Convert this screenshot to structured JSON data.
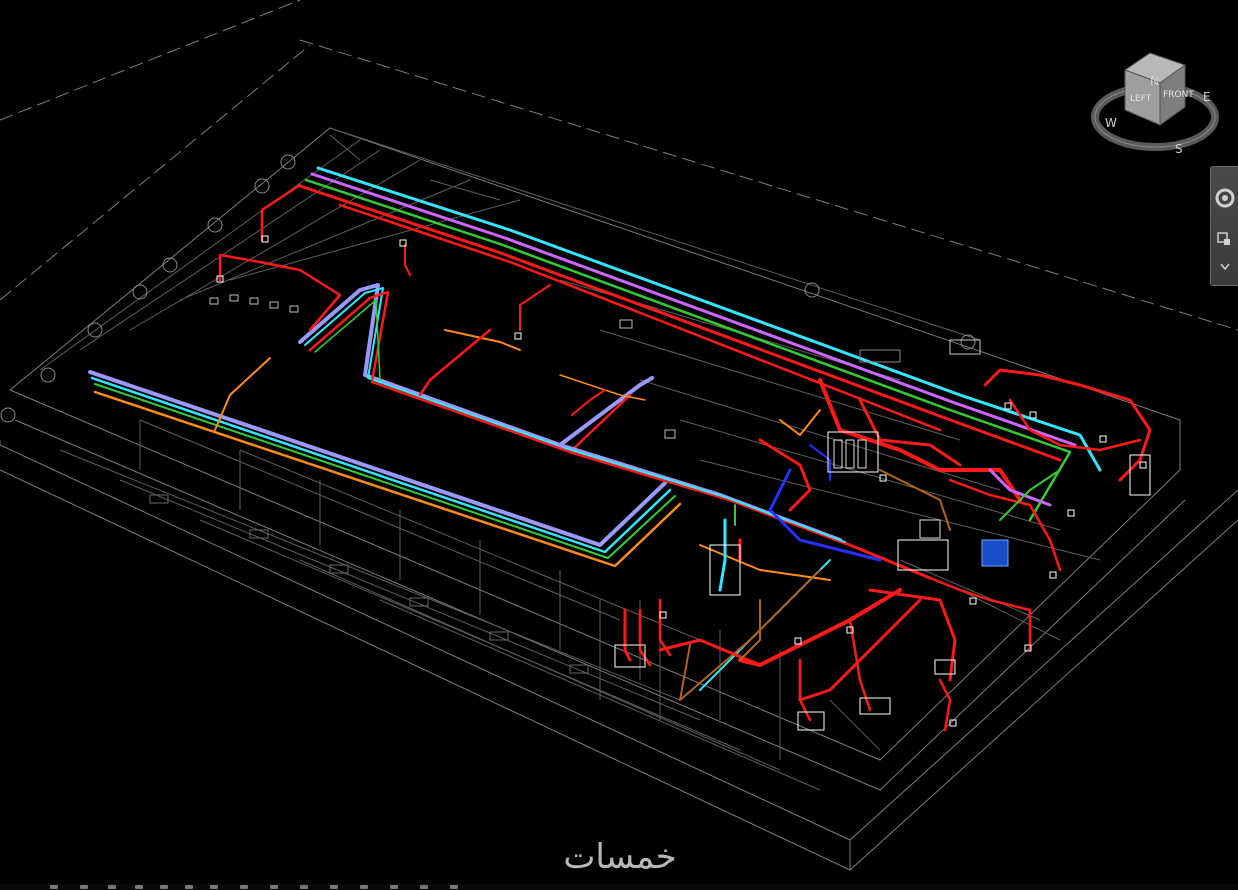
{
  "viewcube": {
    "face_left": "LEFT",
    "face_front": "FRONT",
    "compass": {
      "north": "N",
      "east": "E",
      "south": "S",
      "west": "W"
    }
  },
  "navbar": {
    "steering_wheel_icon": "steering-wheel-icon",
    "pan_zoom_icon": "zoom-icon",
    "menu_icon": "chevron-down-icon"
  },
  "watermark": {
    "text": "خمسات"
  },
  "colors": {
    "background": "#000000",
    "floor_lines": "#8a8a8a",
    "hot_water": "#ff1a1a",
    "cold_water": "#33e6ff",
    "hvac_green": "#33cc33",
    "hvac_violet": "#cc66ff",
    "drain_orange": "#ff8c1a",
    "supply_blue": "#2233ff",
    "duct_lavender": "#9999ff",
    "brown_line": "#b0651a"
  }
}
